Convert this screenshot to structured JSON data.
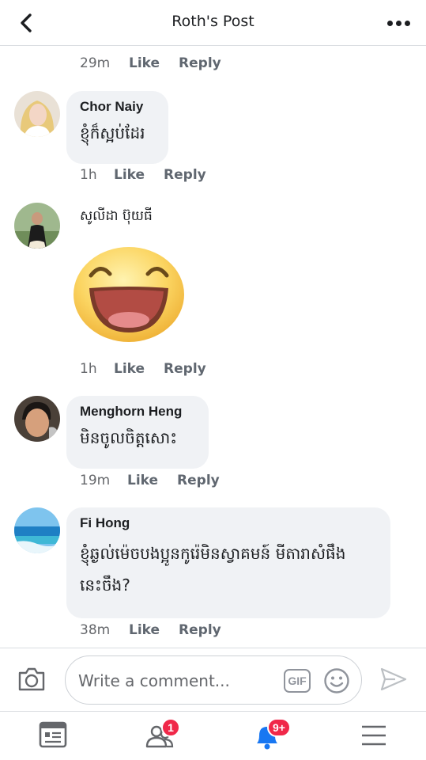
{
  "header": {
    "title": "Roth's Post"
  },
  "comments": [
    {
      "time": "29m",
      "like": "Like",
      "reply": "Reply"
    },
    {
      "name": "Chor Naiy",
      "text": "ខ្ញុំក៏ស្អប់ដែរ",
      "time": "1h",
      "like": "Like",
      "reply": "Reply"
    },
    {
      "name": "សូលីដា ប៊ុយធី",
      "time": "1h",
      "like": "Like",
      "reply": "Reply"
    },
    {
      "name": "Menghorn Heng",
      "text": "មិនចូលចិត្តសោះ",
      "time": "19m",
      "like": "Like",
      "reply": "Reply"
    },
    {
      "name": "Fi Hong",
      "text_line1": "ខ្ញុំឆ្ងល់ម៉េចបងប្អូនកូរ៉េមិនស្វាគមន៍ មីតារាសំផឹង",
      "text_line2": "នេះចឹង?",
      "time": "38m",
      "like": "Like",
      "reply": "Reply"
    }
  ],
  "composer": {
    "placeholder": "Write a comment...",
    "gif_label": "GIF"
  },
  "tabbar": {
    "friends_badge": "1",
    "notifications_badge": "9+"
  },
  "colors": {
    "accent": "#1877f2",
    "badge": "#f02849",
    "bubble": "#f0f2f5"
  }
}
